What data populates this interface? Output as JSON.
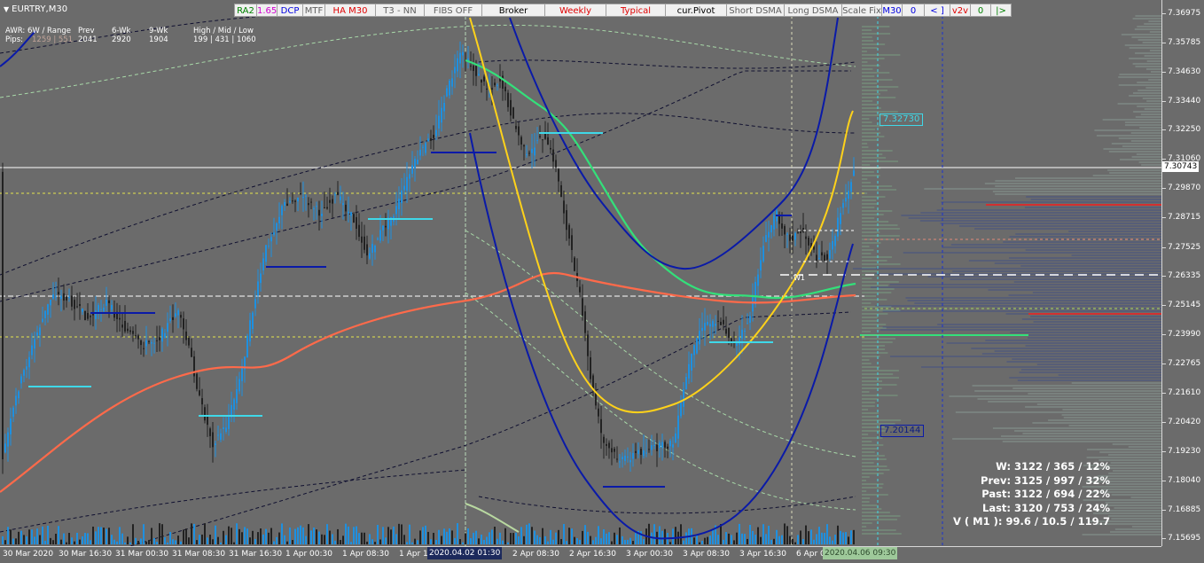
{
  "window": {
    "symbol": "EURTRY,M30",
    "symbol_arrow": "▼"
  },
  "stats": {
    "headers": [
      "AWR: 6W / Range",
      "Prev",
      "6-Wk",
      "9-Wk",
      "High / Mid / Low"
    ],
    "pips_label": "Pips:",
    "awr": "1259 | 551",
    "prev": "2041",
    "wk6": "2920",
    "wk9": "1904",
    "hml": "199 | 431 | 1060"
  },
  "toolbar": {
    "buttons": [
      {
        "label": "RA2",
        "color": "#008000"
      },
      {
        "label": "1.65",
        "color": "#d000d0"
      },
      {
        "label": "DCP",
        "color": "#0000e0"
      },
      {
        "label": "MTF",
        "color": "#606060"
      },
      {
        "label": "HA M30",
        "color": "#e00000"
      },
      {
        "label": "T3 - NN",
        "color": "#606060"
      },
      {
        "label": "FIBS OFF",
        "color": "#606060"
      },
      {
        "label": "Broker",
        "color": "#000000"
      },
      {
        "label": "Weekly",
        "color": "#e00000"
      },
      {
        "label": "Typical",
        "color": "#e00000"
      },
      {
        "label": "cur.Pivot",
        "color": "#000000"
      },
      {
        "label": "Short DSMA",
        "color": "#606060"
      },
      {
        "label": "Long DSMA",
        "color": "#606060"
      },
      {
        "label": "Scale Fix",
        "color": "#606060"
      },
      {
        "label": "M30",
        "color": "#0000e0"
      },
      {
        "label": "0",
        "color": "#0000e0"
      },
      {
        "label": "< ]",
        "color": "#0000e0"
      },
      {
        "label": "v2v",
        "color": "#e00000"
      },
      {
        "label": "0",
        "color": "#008000"
      },
      {
        "label": "|>",
        "color": "#008000"
      }
    ]
  },
  "price_axis": {
    "ticks": [
      "7.36975",
      "7.35785",
      "7.34630",
      "7.33440",
      "7.32250",
      "7.31060",
      "7.29870",
      "7.28715",
      "7.27525",
      "7.26335",
      "7.25145",
      "7.23990",
      "7.22765",
      "7.21610",
      "7.20420",
      "7.19230",
      "7.18040",
      "7.16885",
      "7.15695"
    ],
    "current_price": "7.30743"
  },
  "time_axis": {
    "ticks": [
      "30 Mar 2020",
      "30 Mar 16:30",
      "31 Mar 00:30",
      "31 Mar 08:30",
      "31 Mar 16:30",
      "1 Apr 00:30",
      "1 Apr 08:30",
      "1 Apr 16",
      "2 Apr 08:30",
      "2 Apr 16:30",
      "3 Apr 00:30",
      "3 Apr 08:30",
      "3 Apr 16:30",
      "6 Apr 0"
    ],
    "highlight_1": "2020.04.02 01:30",
    "highlight_2": "2020.04.06 09:30"
  },
  "price_labels": {
    "upper": "7.32730",
    "lower": "7.20144",
    "w1": "W1"
  },
  "bottom_stats": {
    "w": "W: 3122 / 365 / 12%",
    "prev": "Prev: 3125 / 997 / 32%",
    "past": "Past: 3122 / 694 / 22%",
    "last": "Last: 3120 / 753 / 24%",
    "v": "V ( M1 ): 99.6 / 10.5 / 119.7"
  },
  "colors": {
    "background": "#6b6b6b",
    "candles": "#1e90e0",
    "bear_candles": "#222222",
    "blue_channel": "#0a1aa8",
    "yellow_curve": "#ffd21a",
    "green_ma": "#33e07a",
    "orange_ma": "#ff6a4a",
    "cyan_levels": "#3fd8e8",
    "yellow_dash": "#e6e64d"
  }
}
